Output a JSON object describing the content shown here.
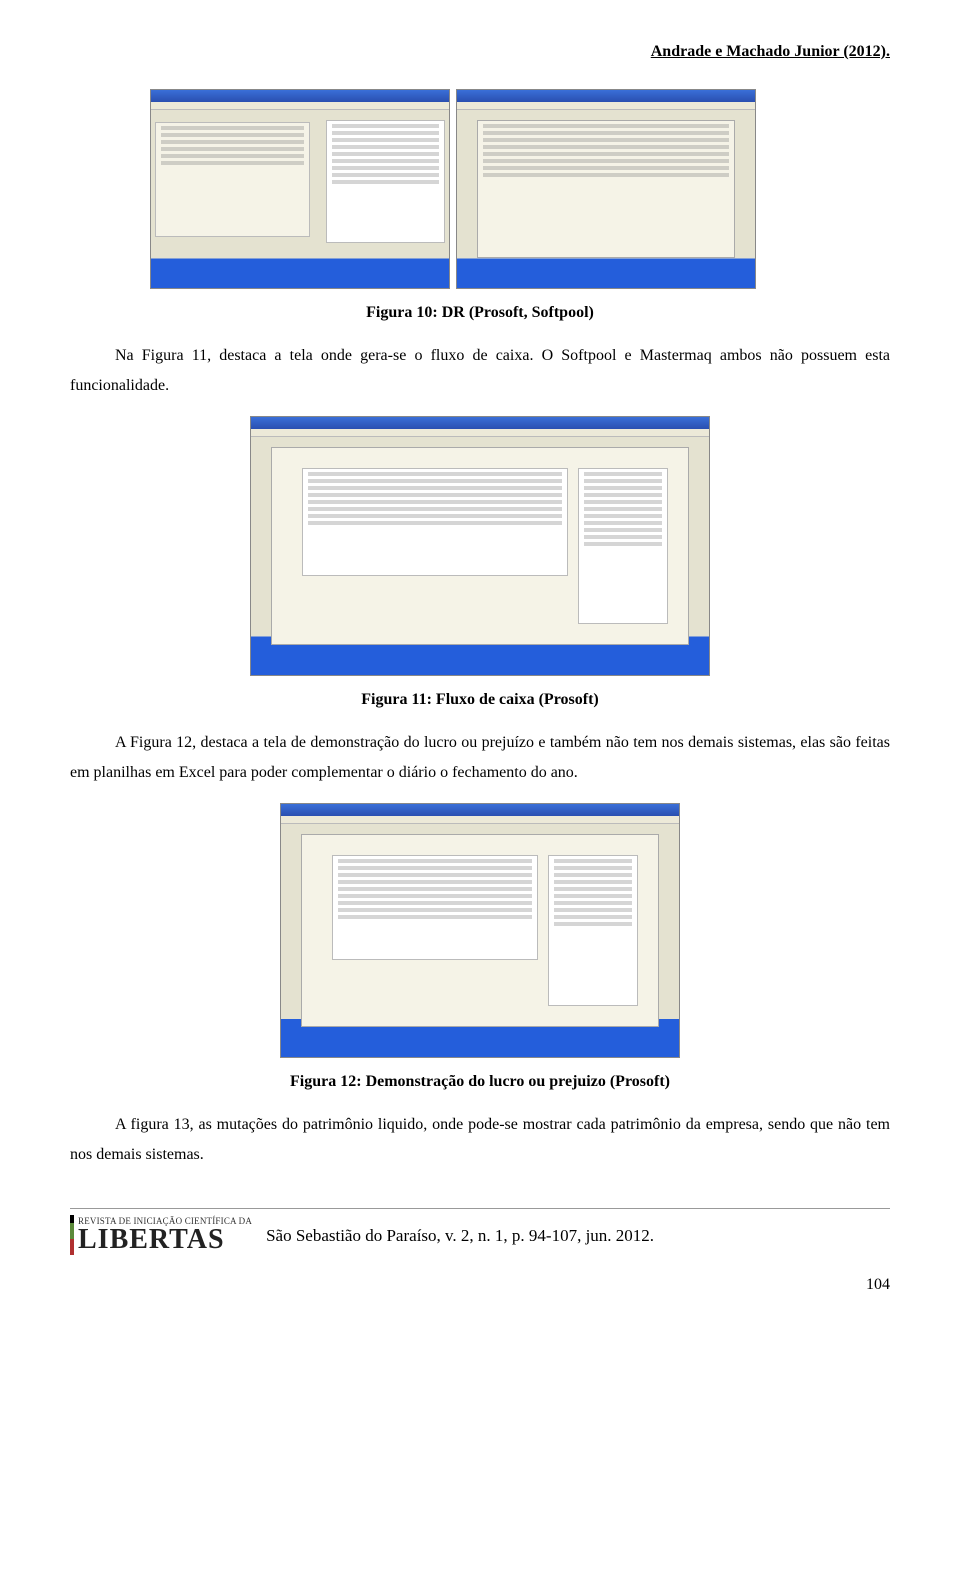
{
  "header": {
    "reference": "Andrade e Machado Junior (2012)."
  },
  "figures": {
    "fig10_caption": "Figura 10: DR (Prosoft, Softpool)",
    "fig11_caption": "Figura 11: Fluxo de caixa (Prosoft)",
    "fig12_caption": "Figura 12: Demonstração do lucro ou prejuizo (Prosoft)"
  },
  "paragraphs": {
    "p1": "Na Figura 11, destaca a tela onde gera-se o fluxo de caixa. O Softpool e Mastermaq ambos não possuem esta funcionalidade.",
    "p2": "A Figura 12, destaca a tela de demonstração do lucro ou prejuízo e também não tem nos demais sistemas, elas são feitas em planilhas em Excel para poder complementar o diário o fechamento do ano.",
    "p3": "A figura 13, as mutações do patrimônio liquido, onde pode-se mostrar cada patrimônio da empresa, sendo que não tem nos demais sistemas."
  },
  "footer": {
    "logo_sub": "REVISTA DE INICIAÇÃO CIENTÍFICA DA",
    "logo_main": "LIBERTAS",
    "citation": "São Sebastião do Paraíso, v. 2, n. 1, p. 94-107, jun. 2012."
  },
  "page_number": "104"
}
